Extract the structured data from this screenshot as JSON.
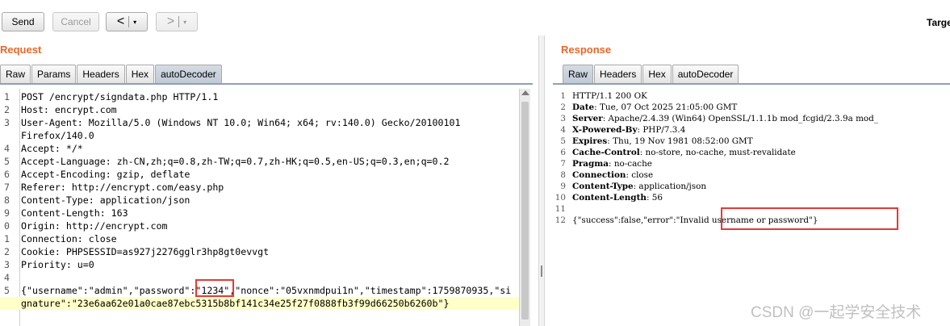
{
  "toolbar": {
    "send_label": "Send",
    "cancel_label": "Cancel",
    "back_arrow": "<",
    "forward_arrow": ">",
    "dropdown_glyph": "▾",
    "target_label": "Targe"
  },
  "request": {
    "title": "Request",
    "tabs": [
      "Raw",
      "Params",
      "Headers",
      "Hex",
      "autoDecoder"
    ],
    "active_tab": "autoDecoder",
    "lines": [
      {
        "n": "1",
        "text": "POST /encrypt/signdata.php HTTP/1.1"
      },
      {
        "n": "2",
        "text": "Host: encrypt.com"
      },
      {
        "n": "3",
        "text": "User-Agent: Mozilla/5.0 (Windows NT 10.0; Win64; x64; rv:140.0) Gecko/20100101"
      },
      {
        "n": "",
        "text": "Firefox/140.0"
      },
      {
        "n": "4",
        "text": "Accept: */*"
      },
      {
        "n": "5",
        "text": "Accept-Language: zh-CN,zh;q=0.8,zh-TW;q=0.7,zh-HK;q=0.5,en-US;q=0.3,en;q=0.2"
      },
      {
        "n": "6",
        "text": "Accept-Encoding: gzip, deflate"
      },
      {
        "n": "7",
        "text": "Referer: http://encrypt.com/easy.php"
      },
      {
        "n": "8",
        "text": "Content-Type: application/json"
      },
      {
        "n": "9",
        "text": "Content-Length: 163"
      },
      {
        "n": "0",
        "text": "Origin: http://encrypt.com"
      },
      {
        "n": "1",
        "text": "Connection: close"
      },
      {
        "n": "2",
        "text": "Cookie: PHPSESSID=as927j2276gglr3hp8gt0evvgt"
      },
      {
        "n": "3",
        "text": "Priority: u=0"
      },
      {
        "n": "4",
        "text": ""
      },
      {
        "n": "5",
        "text": "{\"username\":\"admin\",\"password\":\"1234\",\"nonce\":\"05vxnmdpui1n\",\"timestamp\":1759870935,\"si"
      },
      {
        "n": "",
        "text": "gnature\":\"23e6aa62e01a0cae87ebc5315b8bf141c34e25f27f0888fb3f99d66250b6260b\"}"
      }
    ]
  },
  "response": {
    "title": "Response",
    "tabs": [
      "Raw",
      "Headers",
      "Hex",
      "autoDecoder"
    ],
    "active_tab": "Raw",
    "lines": [
      {
        "n": "1",
        "name": "",
        "value": "HTTP/1.1 200 OK"
      },
      {
        "n": "2",
        "name": "Date",
        "value": ": Tue, 07 Oct 2025 21:05:00 GMT"
      },
      {
        "n": "3",
        "name": "Server",
        "value": ": Apache/2.4.39 (Win64) OpenSSL/1.1.1b mod_fcgid/2.3.9a mod_"
      },
      {
        "n": "4",
        "name": "X-Powered-By",
        "value": ": PHP/7.3.4"
      },
      {
        "n": "5",
        "name": "Expires",
        "value": ": Thu, 19 Nov 1981 08:52:00 GMT"
      },
      {
        "n": "6",
        "name": "Cache-Control",
        "value": ": no-store, no-cache, must-revalidate"
      },
      {
        "n": "7",
        "name": "Pragma",
        "value": ": no-cache"
      },
      {
        "n": "8",
        "name": "Connection",
        "value": ": close"
      },
      {
        "n": "9",
        "name": "Content-Type",
        "value": ": application/json"
      },
      {
        "n": "10",
        "name": "Content-Length",
        "value": ": 56"
      },
      {
        "n": "11",
        "name": "",
        "value": ""
      },
      {
        "n": "12",
        "name": "",
        "value": "{\"success\":false,\"error\":\"Invalid username or password\"}"
      }
    ]
  },
  "watermark": "CSDN @一起学安全技术"
}
